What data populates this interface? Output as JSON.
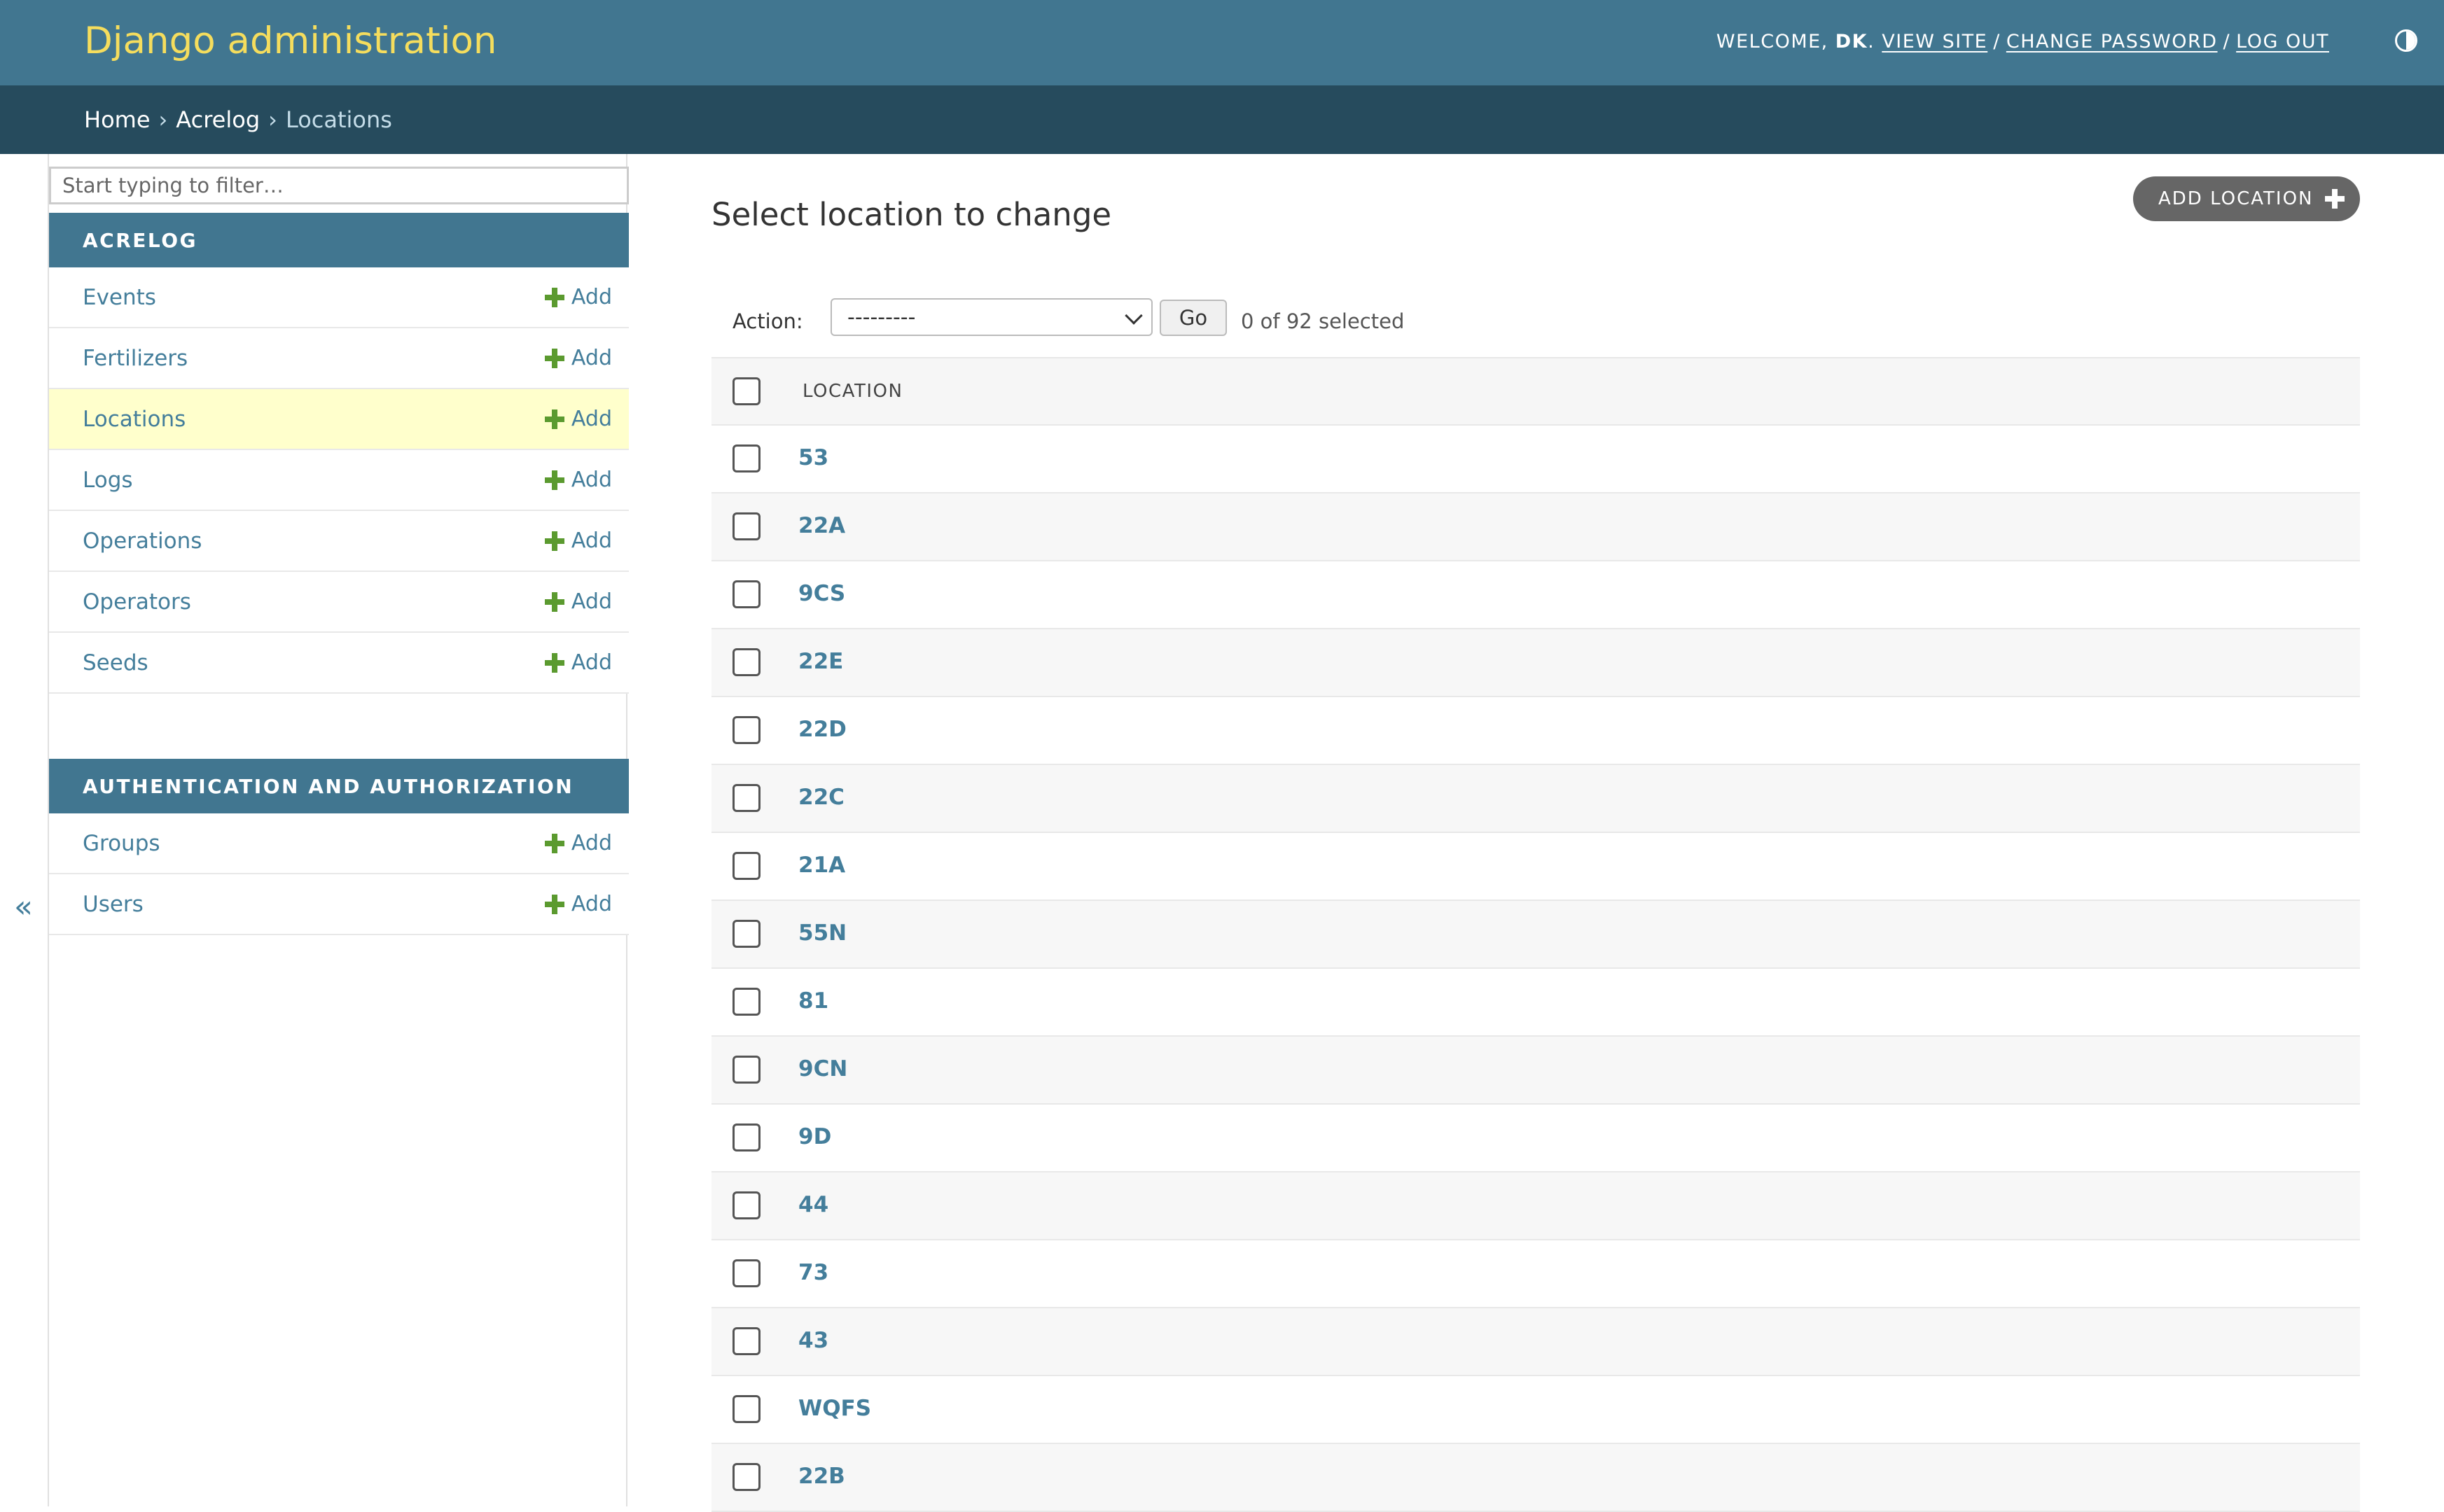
{
  "header": {
    "branding": "Django administration",
    "welcome": "WELCOME,",
    "username": "DK",
    "view_site": "VIEW SITE",
    "change_password": "CHANGE PASSWORD",
    "log_out": "LOG OUT",
    "separator": "/"
  },
  "breadcrumbs": {
    "home": "Home",
    "app": "Acrelog",
    "current": "Locations",
    "sep": "›"
  },
  "sidebar": {
    "filter_placeholder": "Start typing to filter…",
    "acrelog_caption": "ACRELOG",
    "acrelog_items": [
      {
        "label": "Events",
        "add": "Add"
      },
      {
        "label": "Fertilizers",
        "add": "Add"
      },
      {
        "label": "Locations",
        "add": "Add"
      },
      {
        "label": "Logs",
        "add": "Add"
      },
      {
        "label": "Operations",
        "add": "Add"
      },
      {
        "label": "Operators",
        "add": "Add"
      },
      {
        "label": "Seeds",
        "add": "Add"
      }
    ],
    "auth_caption": "AUTHENTICATION AND AUTHORIZATION",
    "auth_items": [
      {
        "label": "Groups",
        "add": "Add"
      },
      {
        "label": "Users",
        "add": "Add"
      }
    ],
    "collapse": "«"
  },
  "content": {
    "title": "Select location to change",
    "add_button": "ADD LOCATION",
    "action_label": "Action:",
    "action_selected": "---------",
    "go": "Go",
    "selected_count": "0 of 92 selected",
    "column_header": "LOCATION",
    "rows": [
      "53",
      "22A",
      "9CS",
      "22E",
      "22D",
      "22C",
      "21A",
      "55N",
      "81",
      "9CN",
      "9D",
      "44",
      "73",
      "43",
      "WQFS",
      "22B"
    ]
  },
  "colors": {
    "header_bg": "#417690",
    "breadcrumb_bg": "#264b5d",
    "branding": "#f5dd5d",
    "link": "#447e9b",
    "active_row": "#ffffcc",
    "add_green": "#5b9a2f"
  }
}
